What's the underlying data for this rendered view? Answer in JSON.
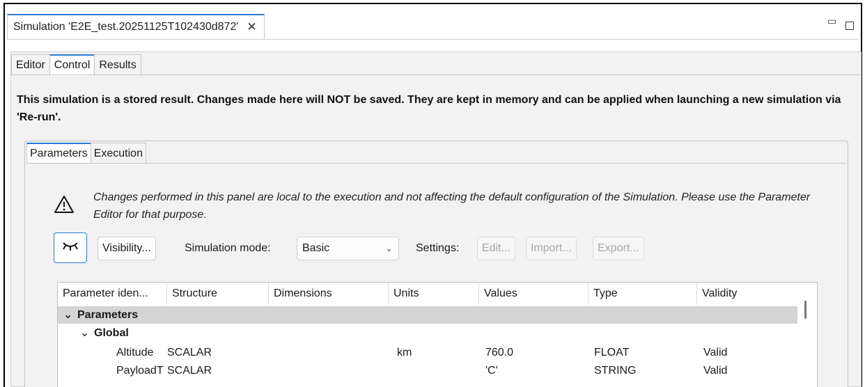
{
  "window": {
    "tab_title": "Simulation 'E2E_test.20251125T102430d872'",
    "close_glyph": "✕",
    "minimize_glyph": "▭",
    "maximize_glyph": ""
  },
  "subtabs": [
    "Editor",
    "Control",
    "Results"
  ],
  "active_subtab": "Control",
  "notice": "This simulation is a stored result. Changes made here will NOT be saved. They are kept in memory and can be applied when launching a new simulation via 'Re-run'.",
  "inner_tabs": [
    "Parameters",
    "Execution"
  ],
  "active_inner_tab": "Parameters",
  "warning": {
    "icon": "warning-triangle-icon",
    "text": "Changes performed in this panel are local to the execution and not affecting the default configuration of the Simulation. Please use the Parameter Editor for that purpose."
  },
  "toolbar": {
    "eye_icon": "closed-eye-icon",
    "visibility_label": "Visibility...",
    "sim_mode_label": "Simulation mode:",
    "sim_mode_value": "Basic",
    "settings_label": "Settings:",
    "edit_label": "Edit...",
    "import_label": "Import...",
    "export_label": "Export..."
  },
  "table": {
    "columns": [
      "Parameter iden...",
      "Structure",
      "Dimensions",
      "Units",
      "Values",
      "Type",
      "Validity"
    ],
    "groups": [
      {
        "label": "Parameters",
        "subgroups": [
          {
            "label": "Global",
            "rows": [
              {
                "id": "Altitude",
                "structure": "SCALAR",
                "dimensions": "",
                "units": "km",
                "values": "760.0",
                "type": "FLOAT",
                "validity": "Valid"
              },
              {
                "id": "PayloadT",
                "structure": "SCALAR",
                "dimensions": "",
                "units": "",
                "values": "'C'",
                "type": "STRING",
                "validity": "Valid"
              }
            ]
          }
        ]
      }
    ]
  },
  "colors": {
    "accent": "#2b7bd5",
    "group_row": "#d4d4d4",
    "panel_bg": "#f2f2f2"
  }
}
